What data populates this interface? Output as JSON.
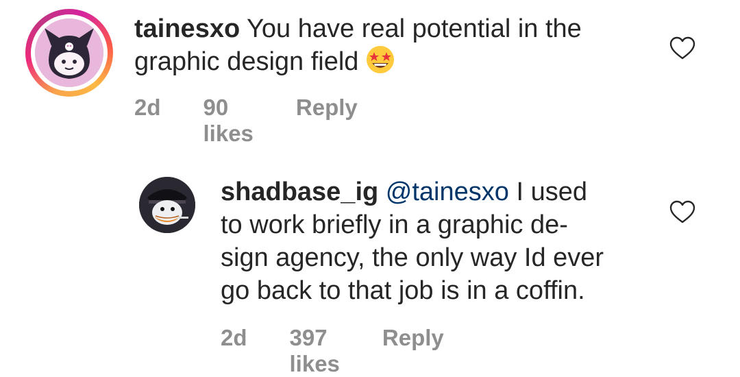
{
  "comments": [
    {
      "username": "tainesxo",
      "mention": "",
      "text_lines": [
        "You have real potential in the",
        "graphic design field"
      ],
      "emoji_name": "star-struck-emoji",
      "time": "2d",
      "likes": "90 likes",
      "reply": "Reply"
    },
    {
      "username": "shadbase_ig",
      "mention": "@tainesxo",
      "text_lines": [
        "I used",
        "to work briefly in a graphic de-",
        "sign agency, the only way Id ever",
        "go back to that job is in a coffin."
      ],
      "time": "2d",
      "likes": "397 likes",
      "reply": "Reply"
    }
  ],
  "icons": {
    "like": "heart-outline-icon"
  }
}
